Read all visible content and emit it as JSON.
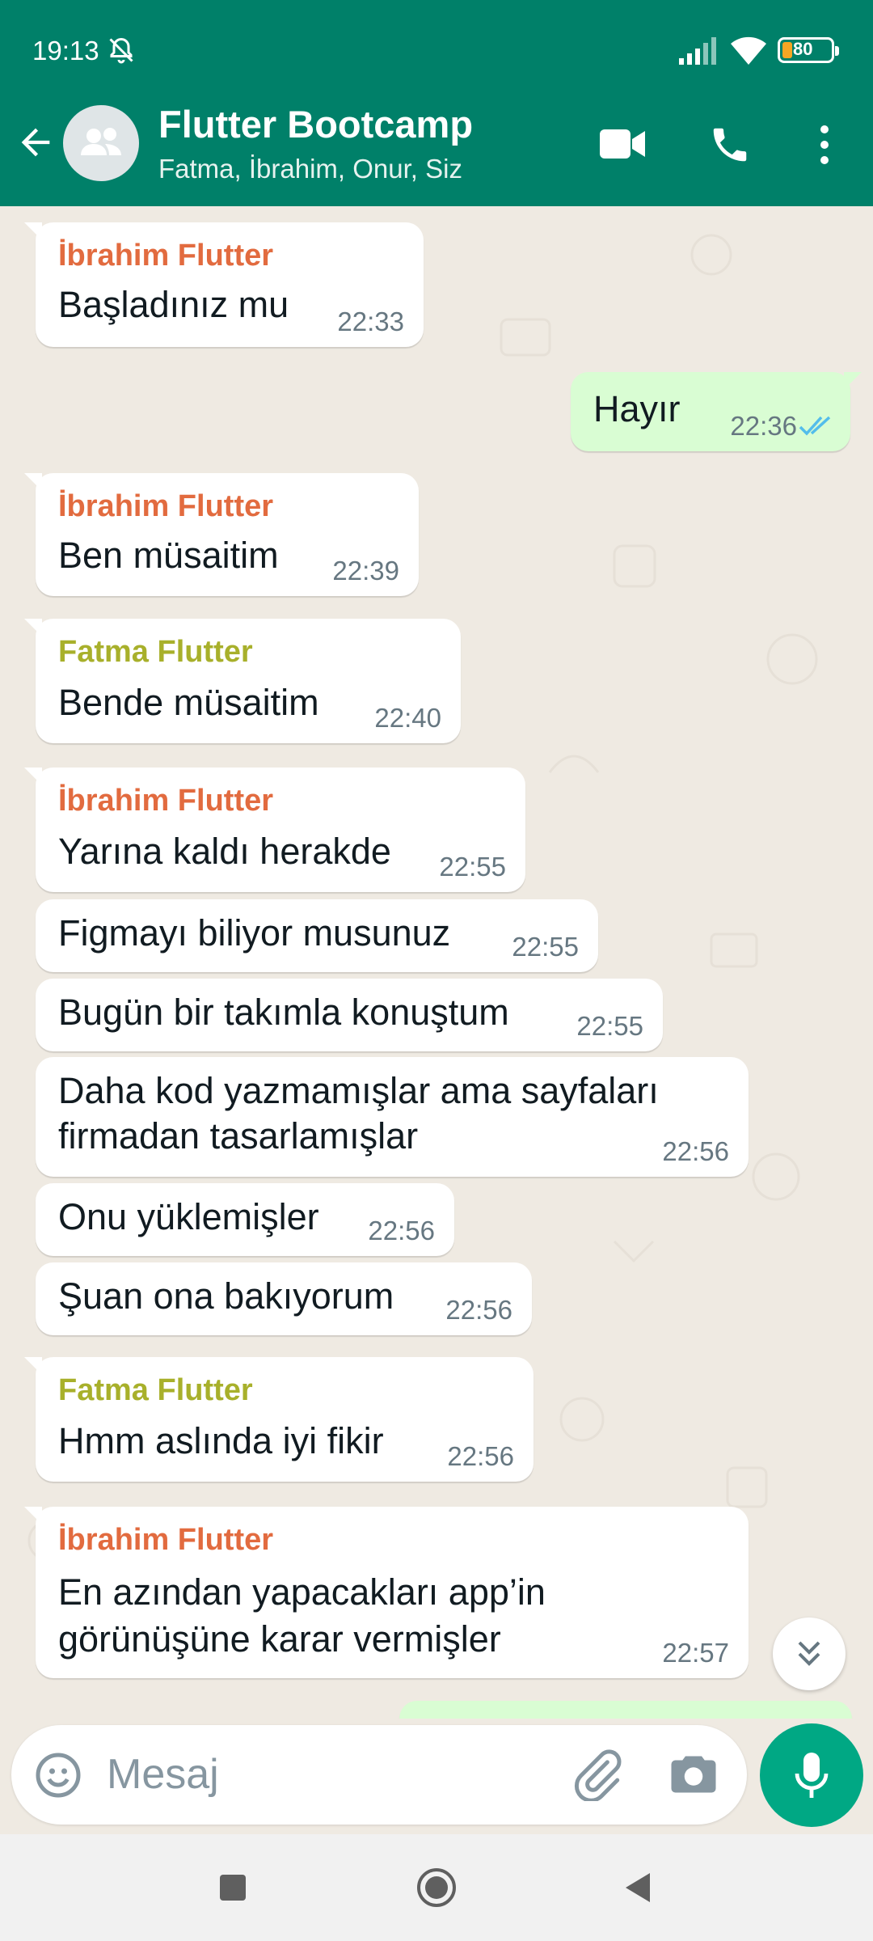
{
  "status_bar": {
    "time": "19:13",
    "battery": "80"
  },
  "header": {
    "title": "Flutter Bootcamp",
    "subtitle": "Fatma, İbrahim, Onur, Siz"
  },
  "colors": {
    "header_bg": "#008069",
    "ibrahim_name": "#e26b3f",
    "fatma_name": "#a8b02b",
    "outgoing_bubble": "#d9fdd3",
    "read_ticks": "#53bdeb",
    "mic_button": "#00a884"
  },
  "messages": [
    {
      "sender": "İbrahim Flutter",
      "text": "Başladınız mu",
      "time": "22:33"
    },
    {
      "sender": "",
      "text": "Hayır",
      "time": "22:36",
      "direction": "outgoing",
      "status": "read"
    },
    {
      "sender": "İbrahim Flutter",
      "text": "Ben müsaitim",
      "time": "22:39"
    },
    {
      "sender": "Fatma Flutter",
      "text": "Bende müsaitim",
      "time": "22:40"
    },
    {
      "sender": "İbrahim Flutter",
      "text": "Yarına kaldı herakde",
      "time": "22:55"
    },
    {
      "sender": "",
      "text": "Figmayı biliyor musunuz",
      "time": "22:55"
    },
    {
      "sender": "",
      "text": "Bugün bir takımla konuştum",
      "time": "22:55"
    },
    {
      "sender": "",
      "text_line1": "Daha kod yazmamışlar ama sayfaları",
      "text_line2": "firmadan tasarlamışlar",
      "time": "22:56"
    },
    {
      "sender": "",
      "text": "Onu yüklemişler",
      "time": "22:56"
    },
    {
      "sender": "",
      "text": "Şuan ona bakıyorum",
      "time": "22:56"
    },
    {
      "sender": "Fatma Flutter",
      "text": "Hmm aslında iyi fikir",
      "time": "22:56"
    },
    {
      "sender": "İbrahim Flutter",
      "text_line1": "En azından yapacakları app’in",
      "text_line2": "görünüşüne karar vermişler",
      "time": "22:57"
    }
  ],
  "input": {
    "placeholder": "Mesaj"
  },
  "icons": {
    "status": [
      "bell-off-icon",
      "signal-icon",
      "wifi-icon",
      "battery-icon"
    ],
    "header": [
      "back-arrow-icon",
      "group-avatar-icon",
      "video-call-icon",
      "voice-call-icon",
      "more-options-icon"
    ],
    "chat": [
      "double-check-icon",
      "scroll-down-icon"
    ],
    "input": [
      "emoji-icon",
      "attach-icon",
      "camera-icon",
      "mic-icon"
    ],
    "nav": [
      "recents-icon",
      "home-icon",
      "back-icon"
    ]
  }
}
